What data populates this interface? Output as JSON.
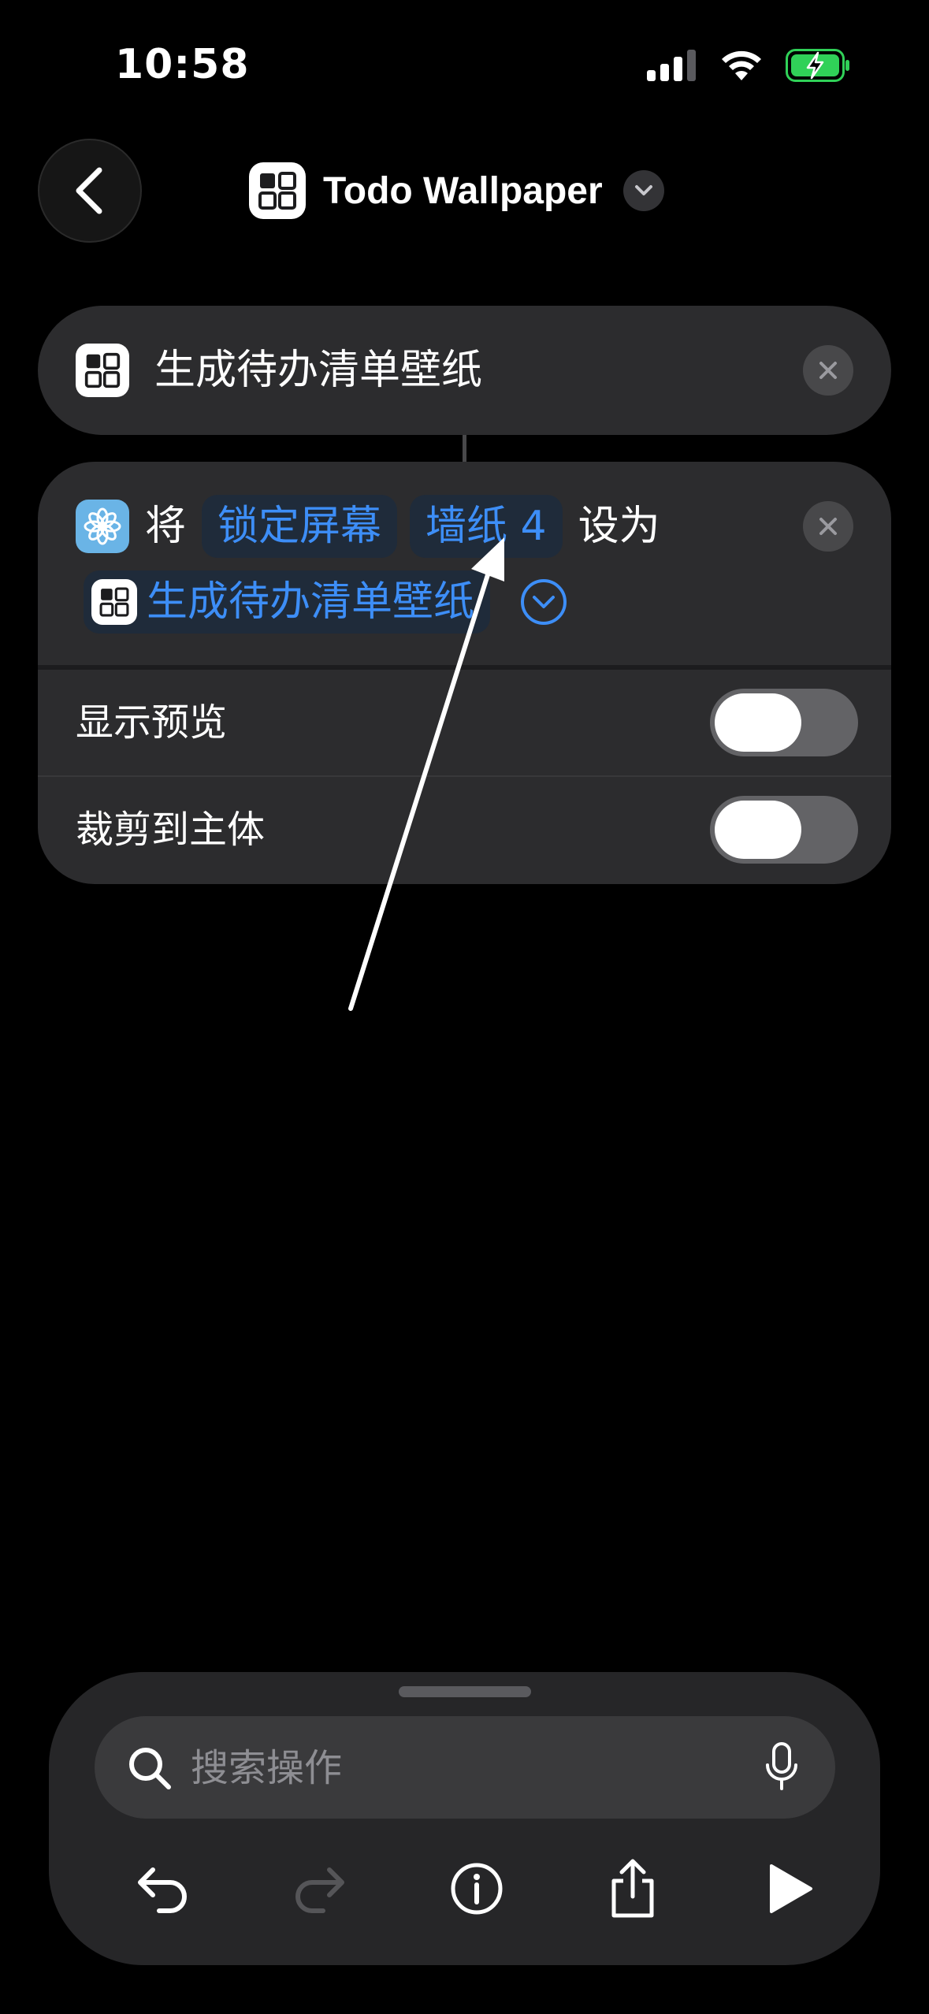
{
  "status_bar": {
    "time": "10:58"
  },
  "header": {
    "title": "Todo Wallpaper"
  },
  "action1": {
    "label": "生成待办清单壁纸"
  },
  "action2": {
    "word_set": "将",
    "token_screen": "锁定屏幕",
    "token_wallpaper": "墙纸 4",
    "word_as": "设为",
    "token_input": "生成待办清单壁纸",
    "options": [
      {
        "label": "显示预览",
        "on": false
      },
      {
        "label": "裁剪到主体",
        "on": false
      }
    ]
  },
  "bottom_panel": {
    "search_placeholder": "搜索操作"
  },
  "colors": {
    "background": "#000000",
    "card": "#2c2c2e",
    "token_text": "#3d8ef7",
    "battery_green": "#30d158"
  },
  "icons": {
    "back": "chevron-left-icon",
    "app": "grid-icon",
    "title_menu": "chevron-down-icon",
    "close": "close-icon",
    "wallpaper_action": "flower-icon",
    "expand": "chevron-down-circle-icon",
    "search": "search-icon",
    "mic": "mic-icon",
    "undo": "undo-icon",
    "redo": "redo-icon",
    "info": "info-icon",
    "share": "share-icon",
    "run": "play-icon"
  }
}
